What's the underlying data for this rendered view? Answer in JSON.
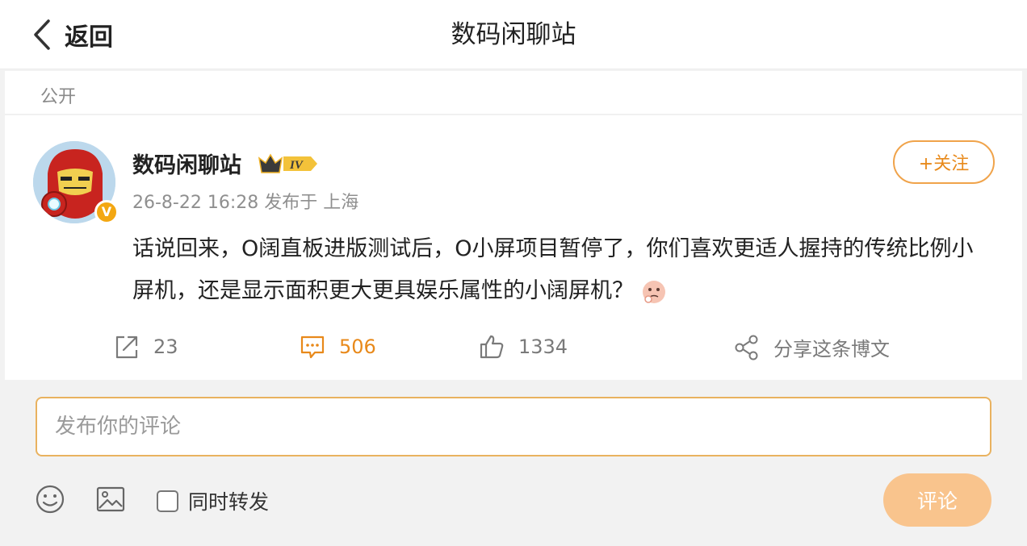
{
  "header": {
    "back_label": "返回",
    "title": "数码闲聊站"
  },
  "visibility": "公开",
  "post": {
    "author": "数码闲聊站",
    "level_badge": "IV",
    "verified_badge": "V",
    "meta": "26-8-22 16:28 发布于 上海",
    "follow_label": "+关注",
    "text": "话说回来，O阔直板进版测试后，O小屏项目暂停了，你们喜欢更适人握持的传统比例小屏机，还是显示面积更大更具娱乐属性的小阔屏机？",
    "actions": {
      "repost_count": "23",
      "comment_count": "506",
      "like_count": "1334",
      "share_label": "分享这条博文"
    }
  },
  "composer": {
    "placeholder": "发布你的评论",
    "repost_label": "同时转发",
    "submit_label": "评论"
  },
  "colors": {
    "accent": "#e8891a",
    "submit_bg": "#f9c48d",
    "border": "#e9b25f"
  },
  "icons": [
    "chevron-left-icon",
    "repost-icon",
    "comment-icon",
    "like-icon",
    "share-icon",
    "emoji-icon",
    "image-icon",
    "crown-badge-icon",
    "verified-badge-icon"
  ]
}
